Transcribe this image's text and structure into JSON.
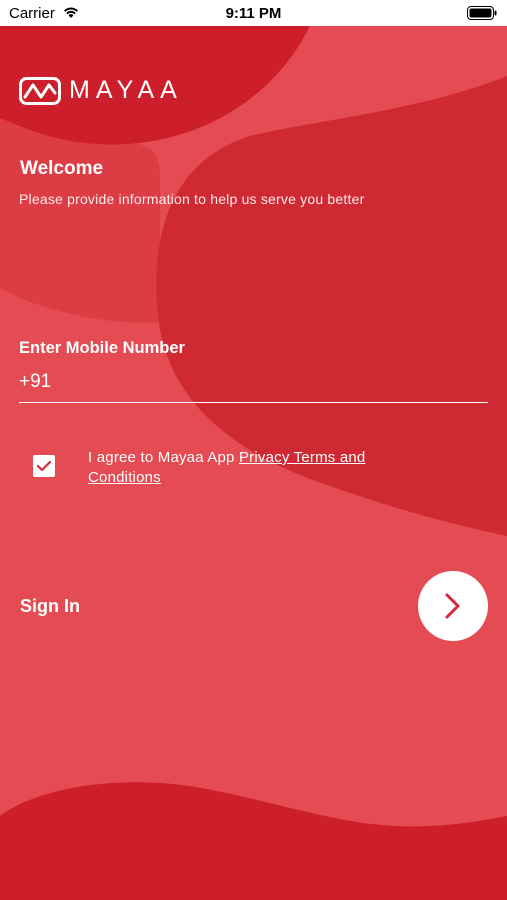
{
  "status_bar": {
    "carrier": "Carrier",
    "time": "9:11 PM"
  },
  "app": {
    "logo_text": "MAYAA",
    "brand_color": "#e44b52",
    "dark_color": "#cd1e2b"
  },
  "welcome": {
    "title": "Welcome",
    "subtitle": "Please provide information to help us serve you better"
  },
  "mobile": {
    "label": "Enter Mobile Number",
    "value": "+91"
  },
  "agreement": {
    "checked": true,
    "text": "I agree to Mayaa App ",
    "link_text": "Privacy Terms and Conditions"
  },
  "sign_in": {
    "label": "Sign In",
    "button_icon": "chevron-right-icon"
  }
}
